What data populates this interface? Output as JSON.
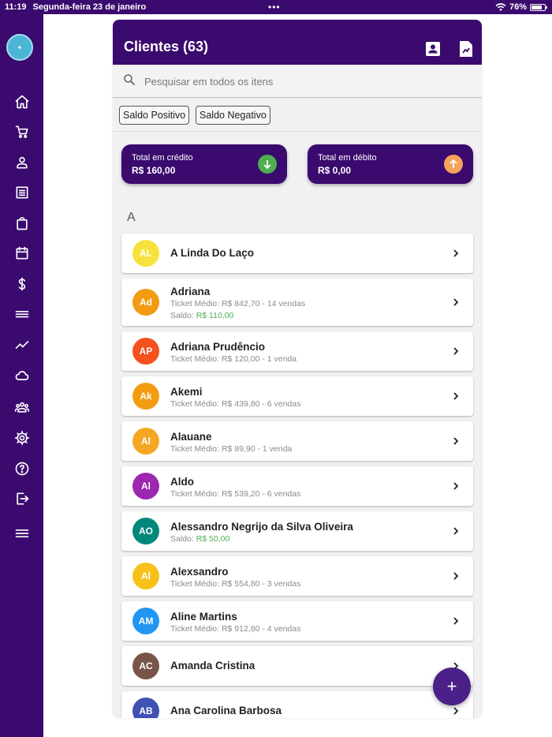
{
  "status_bar": {
    "time": "11:19",
    "date": "Segunda-feira 23 de janeiro",
    "battery": "76%"
  },
  "sidebar": {
    "items": [
      {
        "icon": "home-icon"
      },
      {
        "icon": "cart-icon"
      },
      {
        "icon": "person-icon"
      },
      {
        "icon": "list-icon"
      },
      {
        "icon": "bag-icon"
      },
      {
        "icon": "calendar-icon"
      },
      {
        "icon": "dollar-icon"
      },
      {
        "icon": "card-icon"
      },
      {
        "icon": "chart-icon"
      },
      {
        "icon": "cloud-icon"
      },
      {
        "icon": "people-icon"
      },
      {
        "icon": "gear-icon"
      },
      {
        "icon": "help-icon"
      },
      {
        "icon": "logout-icon"
      },
      {
        "icon": "menu-icon"
      }
    ]
  },
  "header": {
    "title": "Clientes (63)"
  },
  "search": {
    "placeholder": "Pesquisar em todos os itens"
  },
  "filters": {
    "positive": "Saldo Positivo",
    "negative": "Saldo Negativo"
  },
  "totals": {
    "credit_label": "Total em crédito",
    "credit_value": "R$ 160,00",
    "debit_label": "Total em débito",
    "debit_value": "R$ 0,00"
  },
  "section_letter": "A",
  "clients": [
    {
      "initials": "AL",
      "name": "A Linda Do Laço",
      "color": "#f6e23a"
    },
    {
      "initials": "Ad",
      "name": "Adriana",
      "ticket": "Ticket Médio: R$ 842,70 - 14 vendas",
      "saldo_label": "Saldo:",
      "saldo": "R$ 110,00",
      "color": "#f39c12"
    },
    {
      "initials": "AP",
      "name": "Adriana Prudêncio",
      "ticket": "Ticket Médio: R$ 120,00 - 1 venda",
      "color": "#f4511e"
    },
    {
      "initials": "Ak",
      "name": "Akemi",
      "ticket": "Ticket Médio: R$ 439,80 - 6 vendas",
      "color": "#f39c12"
    },
    {
      "initials": "Al",
      "name": "Alauane",
      "ticket": "Ticket Médio: R$ 89,90 - 1 venda",
      "color": "#f5a623"
    },
    {
      "initials": "Al",
      "name": "Aldo",
      "ticket": "Ticket Médio: R$ 539,20 - 6 vendas",
      "color": "#9c27b0"
    },
    {
      "initials": "AO",
      "name": "Alessandro Negrijo da Silva Oliveira",
      "saldo_label": "Saldo:",
      "saldo": "R$ 50,00",
      "color": "#00897b"
    },
    {
      "initials": "Al",
      "name": "Alexsandro",
      "ticket": "Ticket Médio: R$ 554,80 - 3 vendas",
      "color": "#f6c21a"
    },
    {
      "initials": "AM",
      "name": "Aline Martins",
      "ticket": "Ticket Médio: R$ 912,80 - 4 vendas",
      "color": "#2196f3"
    },
    {
      "initials": "AC",
      "name": "Amanda Cristina",
      "color": "#795548"
    },
    {
      "initials": "AB",
      "name": "Ana Carolina Barbosa",
      "color": "#3f51b5"
    }
  ],
  "colors": {
    "brand": "#3a0a6e",
    "credit_icon": "#4caf50",
    "debit_icon": "#f5a25d",
    "saldo": "#4caf50"
  }
}
